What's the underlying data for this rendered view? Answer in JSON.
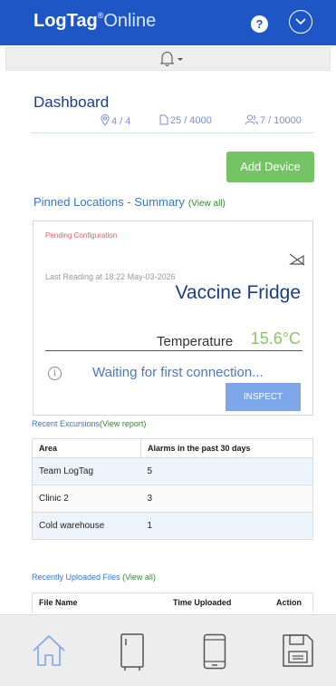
{
  "header": {
    "logo_bold": "LogTag",
    "logo_reg": "®",
    "logo_light": "Online",
    "help_icon": "question-circle-icon",
    "menu_icon": "chevron-down-circle-icon",
    "brand_color": "#1f56c6"
  },
  "notifications": {
    "icon": "bell-icon"
  },
  "dashboard": {
    "title": "Dashboard",
    "stats": {
      "locations": "4 / 4",
      "files": "25 / 4000",
      "users": "7 / 10000"
    },
    "add_device_label": "Add Device",
    "add_device_color": "#74c365"
  },
  "pinned": {
    "title": "Pinned Locations - Summary",
    "view_all": "(View all)",
    "card": {
      "status": "Pending Configuration",
      "last_reading": "Last Reading at 18:22 May-03-2026",
      "device_name": "Vaccine Fridge",
      "temp_label": "Temperature",
      "temp_value": "15.6°C",
      "info_icon": "info-icon",
      "waiting": "Waiting for first connection...",
      "inspect_label": "INSPECT"
    }
  },
  "excursions": {
    "title": "Recent Excursions",
    "view_report": "(View report)",
    "headers": [
      "Area",
      "Alarms in the past 30 days"
    ],
    "rows": [
      {
        "area": "Team LogTag",
        "alarms": "5"
      },
      {
        "area": "Clinic 2",
        "alarms": "3"
      },
      {
        "area": "Cold warehouse",
        "alarms": "1"
      }
    ]
  },
  "uploads": {
    "title": "Recently Uploaded Files",
    "view_all": "(View all)",
    "headers": [
      "File Name",
      "Time Uploaded",
      "Action"
    ]
  },
  "bottom_nav": [
    "home-icon",
    "fridge-icon",
    "mobile-device-icon",
    "save-icon"
  ]
}
